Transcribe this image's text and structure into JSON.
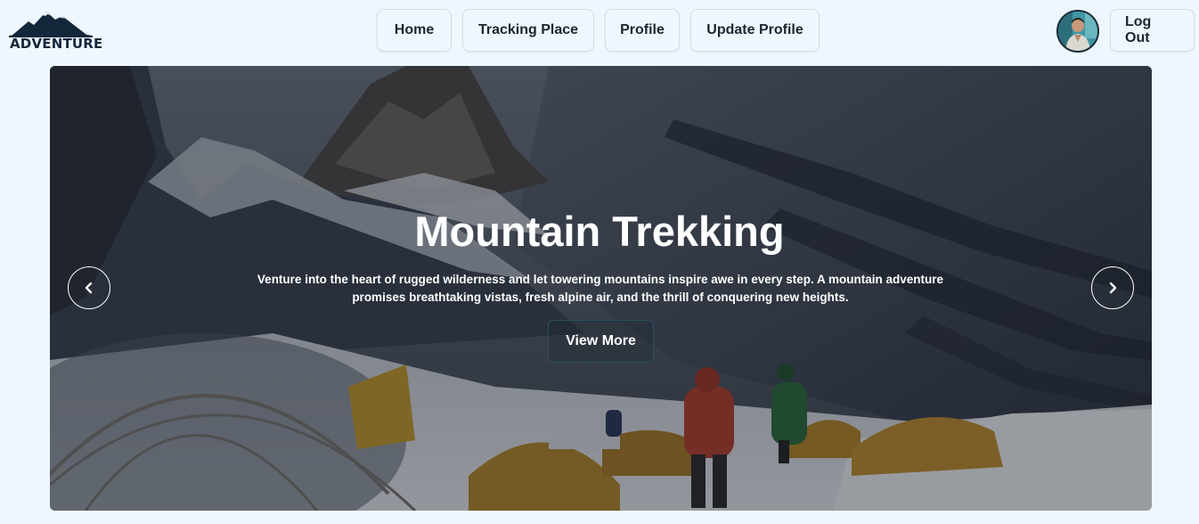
{
  "brand": {
    "name": "ADVENTURE"
  },
  "nav": {
    "items": [
      {
        "label": "Home"
      },
      {
        "label": "Tracking Place"
      },
      {
        "label": "Profile"
      },
      {
        "label": "Update Profile"
      }
    ]
  },
  "user": {
    "logout_label": "Log Out"
  },
  "hero": {
    "title": "Mountain Trekking",
    "description": "Venture into the heart of rugged wilderness and let towering mountains inspire awe in every step. A mountain adventure promises breathtaking vistas, fresh alpine air, and the thrill of conquering new heights.",
    "cta_label": "View More",
    "prev_icon": "chevron-left-icon",
    "next_icon": "chevron-right-icon"
  },
  "colors": {
    "page_bg": "#eef7ff",
    "text_dark": "#1c2530",
    "button_border": "#d4dde6",
    "cta_border": "#2f4f63"
  }
}
